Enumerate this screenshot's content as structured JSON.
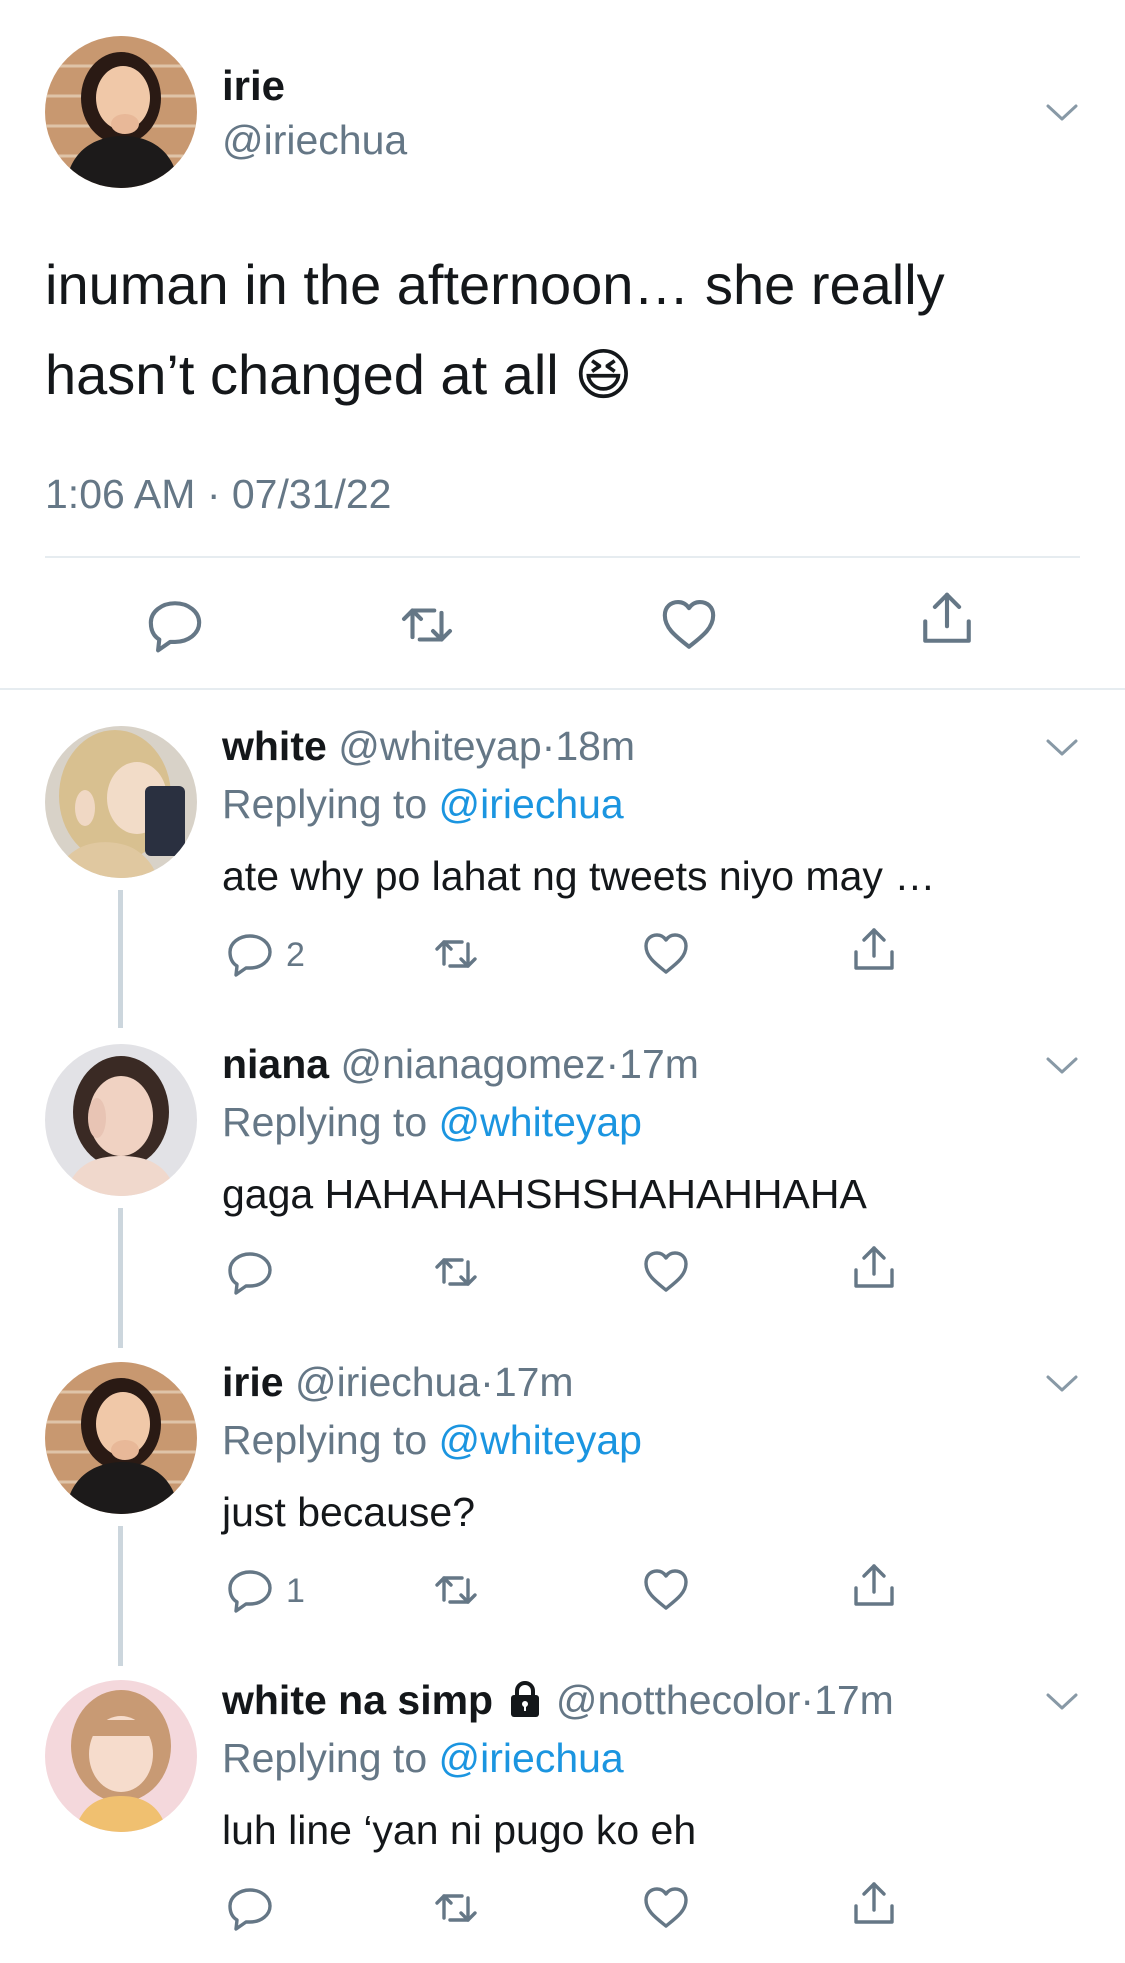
{
  "main_tweet": {
    "name": "irie",
    "handle": "@iriechua",
    "text": "inuman in the afternoon… she really hasn’t changed at all",
    "emoji": "😆",
    "timestamp": "1:06 AM · 07/31/22"
  },
  "replies": [
    {
      "name": "white",
      "handle": "@whiteyap",
      "time": "18m",
      "replying_prefix": "Replying to",
      "replying_to": "@iriechua",
      "text": "ate why po lahat ng tweets niyo may …",
      "reply_count": "2",
      "locked": false
    },
    {
      "name": "niana",
      "handle": "@nianagomez",
      "time": "17m",
      "replying_prefix": "Replying to",
      "replying_to": "@whiteyap",
      "text": "gaga HAHAHAHSHSHAHAHHAHA",
      "reply_count": "",
      "locked": false
    },
    {
      "name": "irie",
      "handle": "@iriechua",
      "time": "17m",
      "replying_prefix": "Replying to",
      "replying_to": "@whiteyap",
      "text": "just because?",
      "reply_count": "1",
      "locked": false
    },
    {
      "name": "white na simp",
      "handle": "@notthecolor",
      "time": "17m",
      "replying_prefix": "Replying to",
      "replying_to": "@iriechua",
      "text": "luh line ‘yan ni pugo ko eh",
      "reply_count": "",
      "locked": true
    }
  ],
  "separator_dot": "·",
  "colors": {
    "text": "#14171a",
    "muted": "#657786",
    "link": "#1b95e0",
    "divider": "#e6ecf0",
    "thread_line": "#ccd6dd",
    "icon": "#657786"
  },
  "icons": [
    "chevron-down-icon",
    "reply-icon",
    "retweet-icon",
    "like-icon",
    "share-icon",
    "lock-icon"
  ]
}
